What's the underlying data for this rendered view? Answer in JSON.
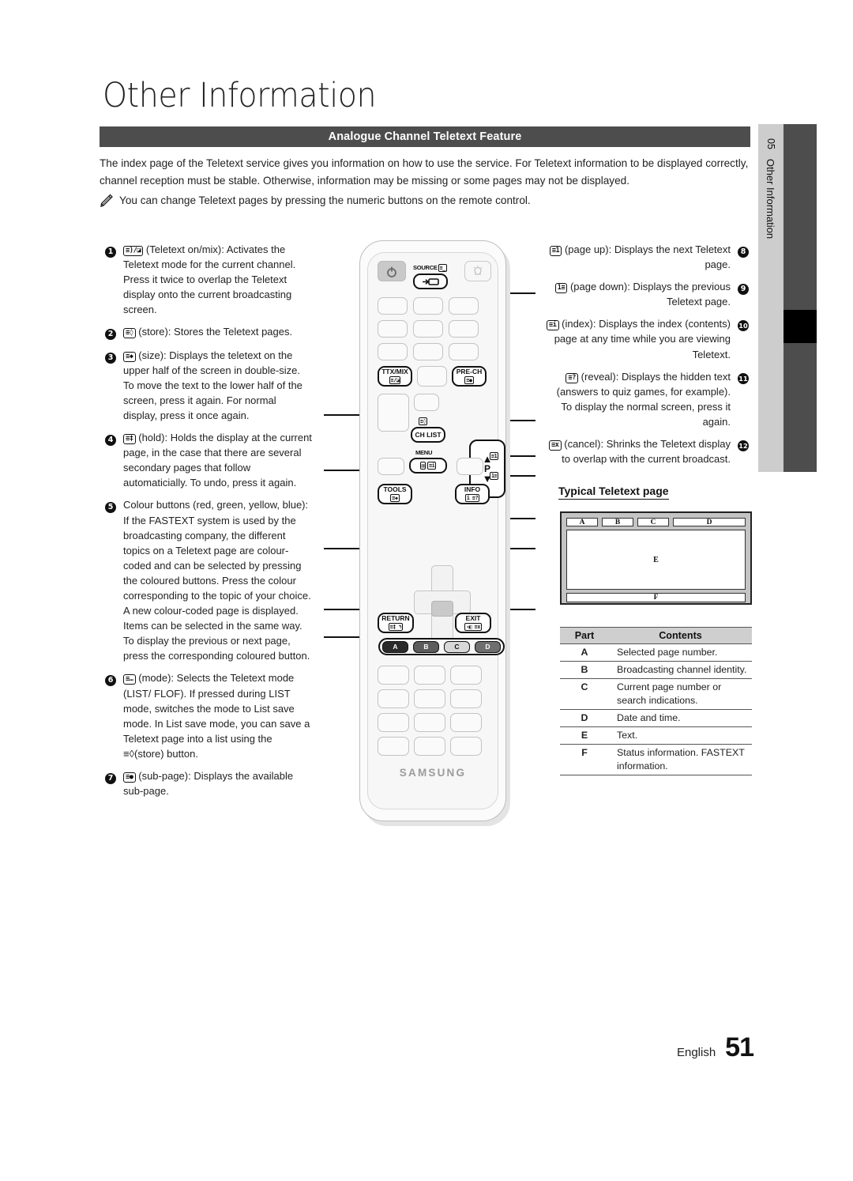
{
  "document": {
    "title": "Other Information",
    "section_header": "Analogue Channel Teletext Feature",
    "intro": "The index page of the Teletext service gives you information on how to use the service. For Teletext information to be displayed correctly, channel reception must be stable. Otherwise, information may be missing or some pages may not be displayed.",
    "note": "You can change Teletext pages by pressing the numeric buttons on the remote control.",
    "note_icon": "pencil-icon"
  },
  "left_items": [
    {
      "number": "1",
      "key": "≡)/◪",
      "text": " (Teletext on/mix): Activates the Teletext mode for the current channel. Press it twice to overlap the Teletext display onto the current broadcasting screen."
    },
    {
      "number": "2",
      "key": "≡◊",
      "text": " (store): Stores the Teletext pages."
    },
    {
      "number": "3",
      "key": "≡◆",
      "text": " (size): Displays the teletext on the upper half of the screen in double-size. To move the text to the lower half of the screen, press it again. For normal display, press it once again."
    },
    {
      "number": "4",
      "key": "≡‡",
      "text": " (hold): Holds the display at the current page, in the case that there are several secondary pages that follow automaticially. To undo, press it again."
    },
    {
      "number": "5",
      "key": "",
      "text": "Colour buttons (red, green, yellow, blue): If the FASTEXT system is used by the broadcasting company, the different topics on a Teletext page are colour-coded and can be selected by pressing the coloured buttons. Press the colour corresponding to the topic of your choice. A new colour-coded page is displayed. Items can be selected in the same way. To display the previous or next page, press the corresponding coloured button."
    },
    {
      "number": "6",
      "key": "≡…",
      "text": " (mode): Selects the Teletext mode (LIST/ FLOF). If pressed during LIST mode, switches the mode to List save mode. In List save mode, you can save a Teletext page into a list using the ≡◊(store) button."
    },
    {
      "number": "7",
      "key": "≡●",
      "text": " (sub-page): Displays the available sub-page."
    }
  ],
  "right_items": [
    {
      "number": "8",
      "key": "≡1",
      "text": " (page up): Displays the next Teletext page."
    },
    {
      "number": "9",
      "key": "1≡",
      "text": " (page down): Displays the previous Teletext page."
    },
    {
      "number": "10",
      "key": "≡i",
      "text": " (index): Displays the index (contents) page at any time while you are viewing Teletext."
    },
    {
      "number": "11",
      "key": "≡?",
      "text": " (reveal): Displays the hidden text (answers to quiz games, for example). To display the normal screen, press it again."
    },
    {
      "number": "12",
      "key": "≡x",
      "text": " (cancel): Shrinks the Teletext display to overlap with the current broadcast."
    }
  ],
  "remote": {
    "brand": "SAMSUNG",
    "power_icon": "power-icon",
    "light_icon": "bulb-icon",
    "source_label": "SOURCE",
    "source_glyph": "≡_",
    "source_button_icon": "source-arrow-icon",
    "ttx_label": "TTX/MIX",
    "ttx_glyph": "≡/◪",
    "prech_label": "PRE-CH",
    "prech_glyph": "≡●",
    "store_glyph": "≡◊",
    "chlist_label": "CH LIST",
    "menu_label": "MENU",
    "menu_glyph_a": "▥",
    "menu_glyph_b": "≡i",
    "p_label": "P",
    "p_up_glyph": "≡1",
    "p_down_glyph": "1≡",
    "tools_label": "TOOLS",
    "tools_glyph": "≡◆",
    "tools_glyph2": "⇱",
    "info_label": "INFO",
    "info_glyph": "i ≡?",
    "return_label": "RETURN",
    "return_glyph": "≡‡ ↰",
    "exit_label": "EXIT",
    "exit_glyph": "-◧ ≡x",
    "colour_buttons": [
      "A",
      "B",
      "C",
      "D"
    ]
  },
  "teletext_page": {
    "heading": "Typical Teletext page",
    "regions_top": [
      "A",
      "B",
      "C",
      "D"
    ],
    "region_body": "E",
    "region_footer": "F"
  },
  "part_table": {
    "headers": [
      "Part",
      "Contents"
    ],
    "rows": [
      {
        "part": "A",
        "contents": "Selected page number."
      },
      {
        "part": "B",
        "contents": "Broadcasting channel identity."
      },
      {
        "part": "C",
        "contents": "Current page number or search indications."
      },
      {
        "part": "D",
        "contents": "Date and time."
      },
      {
        "part": "E",
        "contents": "Text."
      },
      {
        "part": "F",
        "contents": "Status information. FASTEXT information."
      }
    ]
  },
  "side_tab": {
    "number": "05",
    "label": "Other Information"
  },
  "footer": {
    "language": "English",
    "page_number": "51"
  }
}
